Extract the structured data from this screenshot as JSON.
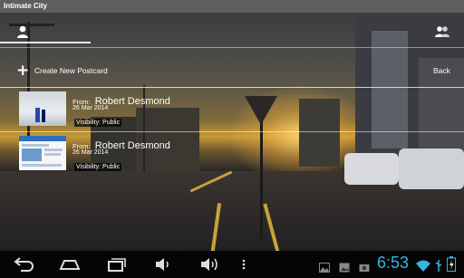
{
  "window": {
    "title": "Intimate City"
  },
  "tabs": [
    {
      "name": "tab-my-postcards",
      "icon": "person-icon",
      "active": true
    },
    {
      "name": "tab-shared",
      "icon": "people-icon",
      "active": false
    }
  ],
  "actions": {
    "create_label": "Create New Postcard",
    "create_icon": "plus-icon",
    "back_label": "Back"
  },
  "postcards": [
    {
      "from_label": "From:",
      "from_name": "Robert Desmond",
      "date": "26 Mar 2014",
      "visibility": "Visibility: Public",
      "thumbnail": "photo-of-people"
    },
    {
      "from_label": "From:",
      "from_name": "Robert Desmond",
      "date": "26 Mar 2014",
      "visibility": "Visibility: Public",
      "thumbnail": "webpage-screenshot"
    }
  ],
  "system_bar": {
    "time": "6:53",
    "nav_buttons": [
      "back-icon",
      "home-icon",
      "recent-apps-icon",
      "volume-down-icon",
      "volume-up-icon",
      "menu-icon"
    ],
    "status_icons": [
      "gallery-icon",
      "image-icon",
      "camera-icon",
      "usb-icon",
      "wifi-icon",
      "battery-icon"
    ],
    "clock_color": "#33b5e5"
  }
}
